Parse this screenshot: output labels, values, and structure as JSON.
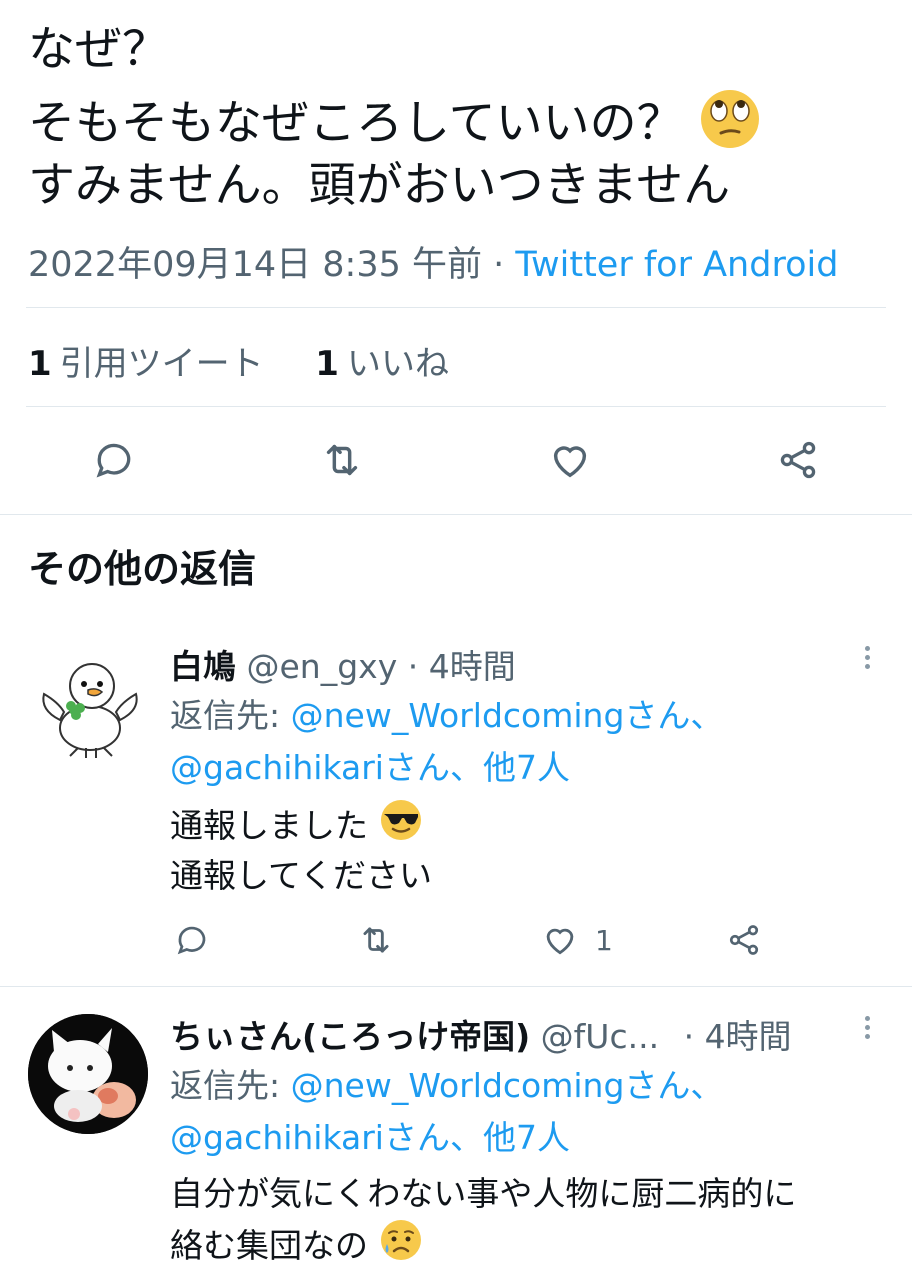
{
  "tweet": {
    "line1": "なぜ？",
    "line2": "そもそもなぜころしていいの？",
    "line2_emoji": "face-with-rolling-eyes",
    "line3": "すみません。頭がおいつきません",
    "timestamp": "2022年09月14日 8:35 午前",
    "separator": "·",
    "source": "Twitter for Android"
  },
  "stats": {
    "quote_count": "1",
    "quote_label": "引用ツイート",
    "like_count": "1",
    "like_label": "いいね"
  },
  "actions": [
    "reply-icon",
    "retweet-icon",
    "like-icon",
    "share-icon"
  ],
  "section": {
    "title": "その他の返信"
  },
  "replies": [
    {
      "name": "白鳩",
      "handle": "@en_gxy",
      "separator": "·",
      "time": "4時間",
      "reply_prefix": "返信先: ",
      "mention1": "@new_Worldcomingさん、",
      "mention2": "@gachihikariさん、他7人",
      "text1": "通報しました",
      "text1_emoji": "smiling-face-with-sunglasses",
      "text2": "通報してください",
      "like_count": "1"
    },
    {
      "name": "ちぃさん(ころっけ帝国)",
      "handle": "@fUc...",
      "separator": "·",
      "time": "4時間",
      "reply_prefix": "返信先: ",
      "mention1": "@new_Worldcomingさん、",
      "mention2": "@gachihikariさん、他7人",
      "text1": "自分が気にくわない事や人物に厨二病的に",
      "text2": "絡む集団なの",
      "text2_emoji": "sad-but-relieved-face"
    }
  ],
  "colors": {
    "accent": "#1d9bf0",
    "secondary": "#536471",
    "divider": "#e1e8ed"
  }
}
